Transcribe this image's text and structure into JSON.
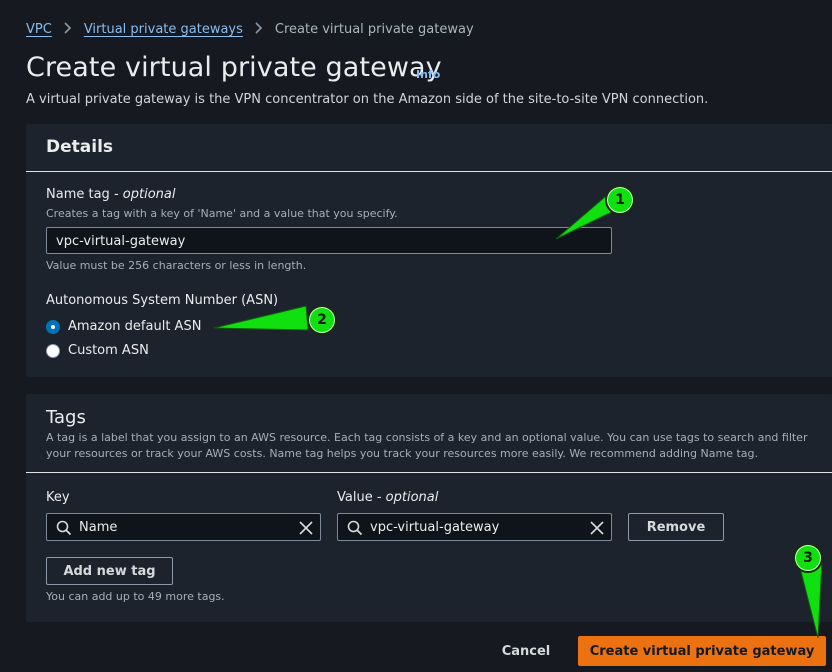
{
  "breadcrumb": {
    "items": [
      "VPC",
      "Virtual private gateways"
    ],
    "current": "Create virtual private gateway",
    "separator": ">"
  },
  "header": {
    "title": "Create virtual private gateway",
    "info_link": "Info",
    "description": "A virtual private gateway is the VPN concentrator on the Amazon side of the site-to-site VPN connection."
  },
  "details": {
    "heading": "Details",
    "name_tag": {
      "label": "Name tag",
      "label_suffix": "optional",
      "description": "Creates a tag with a key of 'Name' and a value that you specify.",
      "value": "vpc-virtual-gateway",
      "constraint": "Value must be 256 characters or less in length."
    },
    "asn": {
      "label": "Autonomous System Number (ASN)",
      "options": [
        "Amazon default ASN",
        "Custom ASN"
      ],
      "selected": "Amazon default ASN"
    }
  },
  "tags": {
    "heading": "Tags",
    "description_line1": "A tag is a label that you assign to an AWS resource. Each tag consists of a key and an optional value. You can use tags to search and filter",
    "description_line2": "your resources or track your AWS costs. Name tag helps you track your resources more easily. We recommend adding Name tag.",
    "key_label": "Key",
    "value_label": "Value",
    "value_label_suffix": "optional",
    "rows": [
      {
        "key": "Name",
        "value": "vpc-virtual-gateway"
      }
    ],
    "remove_label": "Remove",
    "add_label": "Add new tag",
    "limit_note": "You can add up to 49 more tags."
  },
  "footer": {
    "cancel_label": "Cancel",
    "submit_label": "Create virtual private gateway"
  },
  "callouts": [
    "1",
    "2",
    "3"
  ],
  "colors": {
    "page_bg": "#16191f",
    "panel_bg": "#1d232c",
    "link": "#89bdee",
    "primary": "#ec7211",
    "radio_selected": "#0073bb",
    "callout": "#10e010"
  }
}
